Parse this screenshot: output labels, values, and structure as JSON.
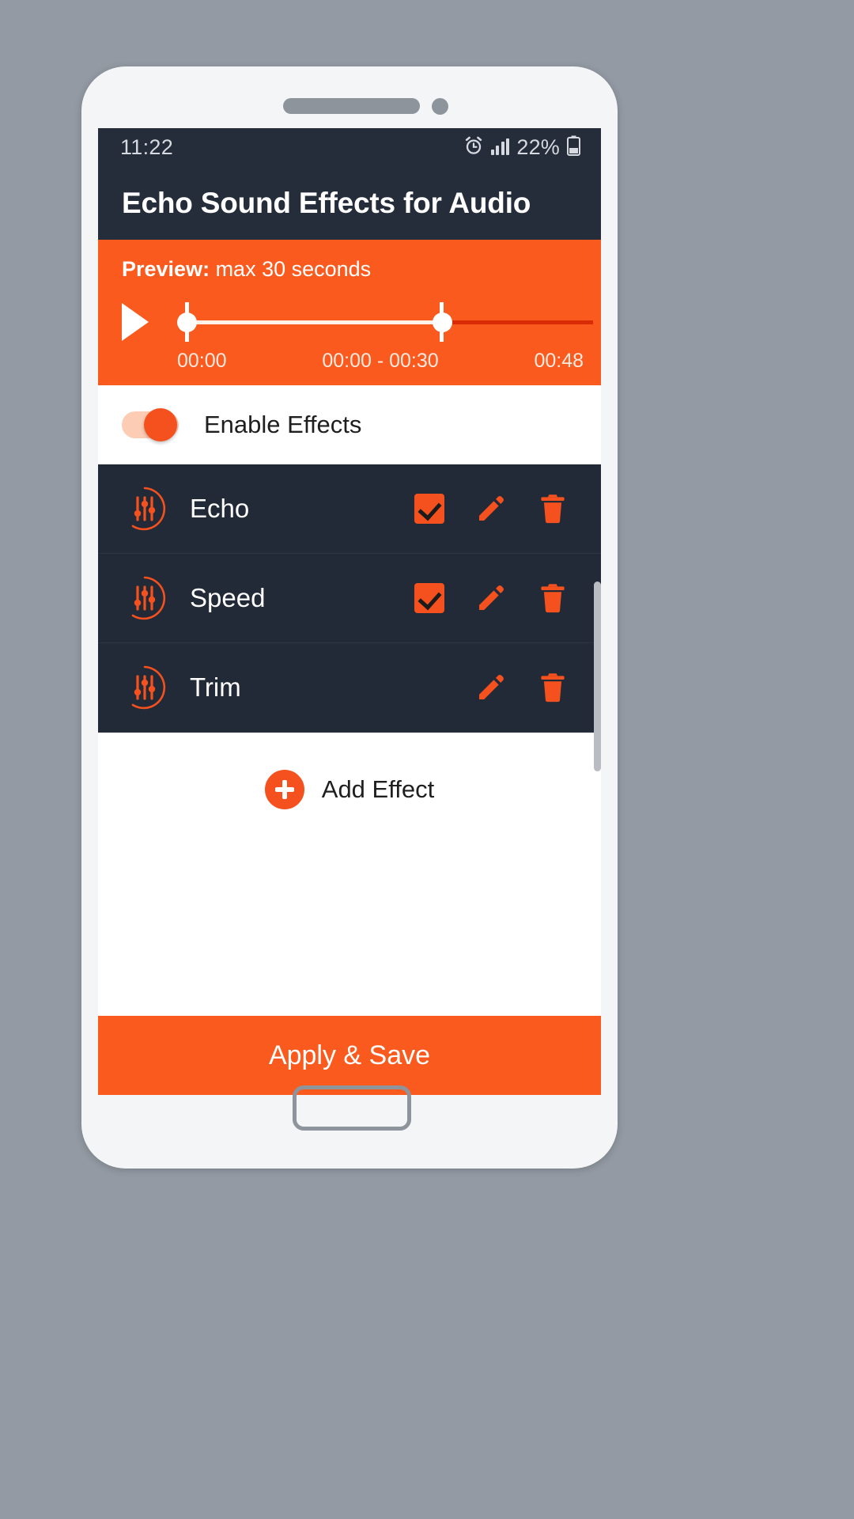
{
  "status_bar": {
    "time": "11:22",
    "battery_percent": "22%",
    "icons": [
      "alarm-clock-icon",
      "signal-bars-icon",
      "battery-icon"
    ]
  },
  "header": {
    "title": "Echo Sound Effects for Audio"
  },
  "preview": {
    "label_bold": "Preview:",
    "label_rest": " max 30 seconds",
    "play_icon": "play-icon",
    "time_start": "00:00",
    "time_range": "00:00 - 00:30",
    "time_total": "00:48",
    "selection_start_pct": 0,
    "selection_end_pct": 62.5
  },
  "enable_effects": {
    "label": "Enable Effects",
    "state": "on"
  },
  "effects": [
    {
      "name": "Echo",
      "icon": "equalizer-icon",
      "checked": true,
      "has_checkbox": true,
      "edit_icon": "pencil-icon",
      "delete_icon": "trash-icon"
    },
    {
      "name": "Speed",
      "icon": "equalizer-icon",
      "checked": true,
      "has_checkbox": true,
      "edit_icon": "pencil-icon",
      "delete_icon": "trash-icon"
    },
    {
      "name": "Trim",
      "icon": "equalizer-icon",
      "checked": false,
      "has_checkbox": false,
      "edit_icon": "pencil-icon",
      "delete_icon": "trash-icon"
    }
  ],
  "add_effect": {
    "label": "Add Effect",
    "icon": "plus-circle-icon"
  },
  "footer": {
    "apply_save_label": "Apply & Save"
  },
  "colors": {
    "accent_orange": "#fa5a1e",
    "button_orange": "#f4511e",
    "dark_navy": "#222a38",
    "status_navy": "#252c3a",
    "track_red": "#d92b06",
    "toggle_track": "#fcccb4"
  }
}
